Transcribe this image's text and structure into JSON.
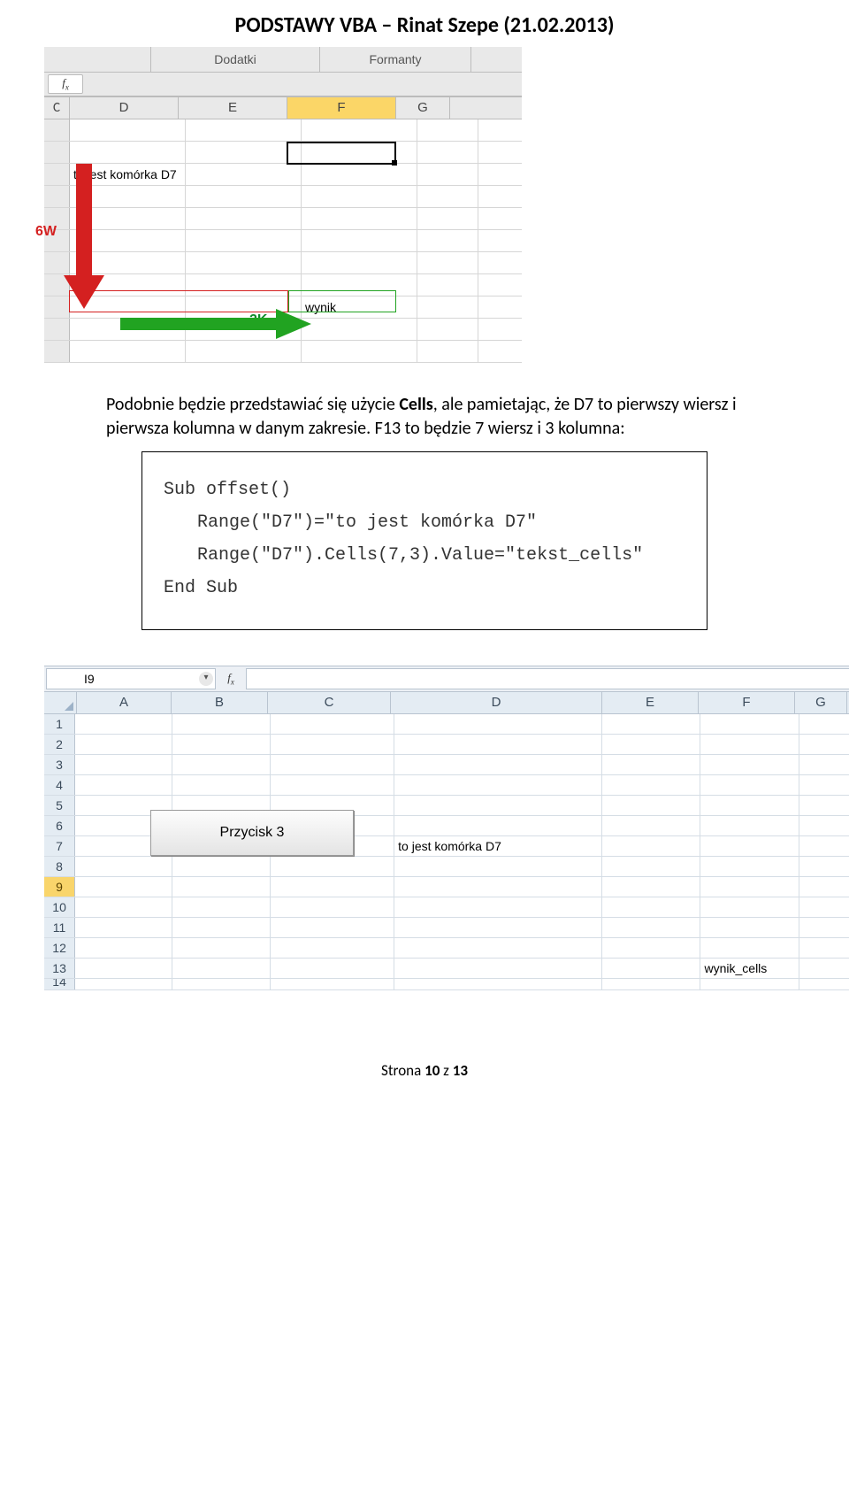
{
  "title": "PODSTAWY VBA – Rinat Szepe (21.02.2013)",
  "shot1": {
    "ribbon": {
      "tab1": "Dodatki",
      "tab2": "Formanty"
    },
    "cols": {
      "c": "C",
      "d": "D",
      "e": "E",
      "f": "F",
      "g": "G"
    },
    "d7_text": "to jest komórka D7",
    "f13_text": "wynik",
    "lbl6w": "6W",
    "lbl2k": "2K"
  },
  "para": {
    "p1_pre": "Podobnie będzie przedstawiać się użycie ",
    "p1_b": "Cells",
    "p1_post": ", ale pamietając, że D7 to pierwszy wiersz i pierwsza kolumna w danym zakresie. F13 to będzie 7 wiersz i 3 kolumna:"
  },
  "code": {
    "l1": "Sub offset()",
    "l2": "Range(\"D7\")=\"to jest komórka D7\"",
    "l3": "Range(\"D7\").Cells(7,3).Value=\"tekst_cells\"",
    "l4": "End Sub"
  },
  "shot2": {
    "namebox": "I9",
    "cols": {
      "a": "A",
      "b": "B",
      "c": "C",
      "d": "D",
      "e": "E",
      "f": "F",
      "g": "G"
    },
    "rows": [
      "1",
      "2",
      "3",
      "4",
      "5",
      "6",
      "7",
      "8",
      "9",
      "10",
      "11",
      "12",
      "13",
      "14"
    ],
    "button": "Przycisk 3",
    "d7": "to jest komórka D7",
    "f13": "wynik_cells"
  },
  "footer": {
    "pre": "Strona ",
    "pg": "10",
    "mid": " z ",
    "total": "13"
  }
}
